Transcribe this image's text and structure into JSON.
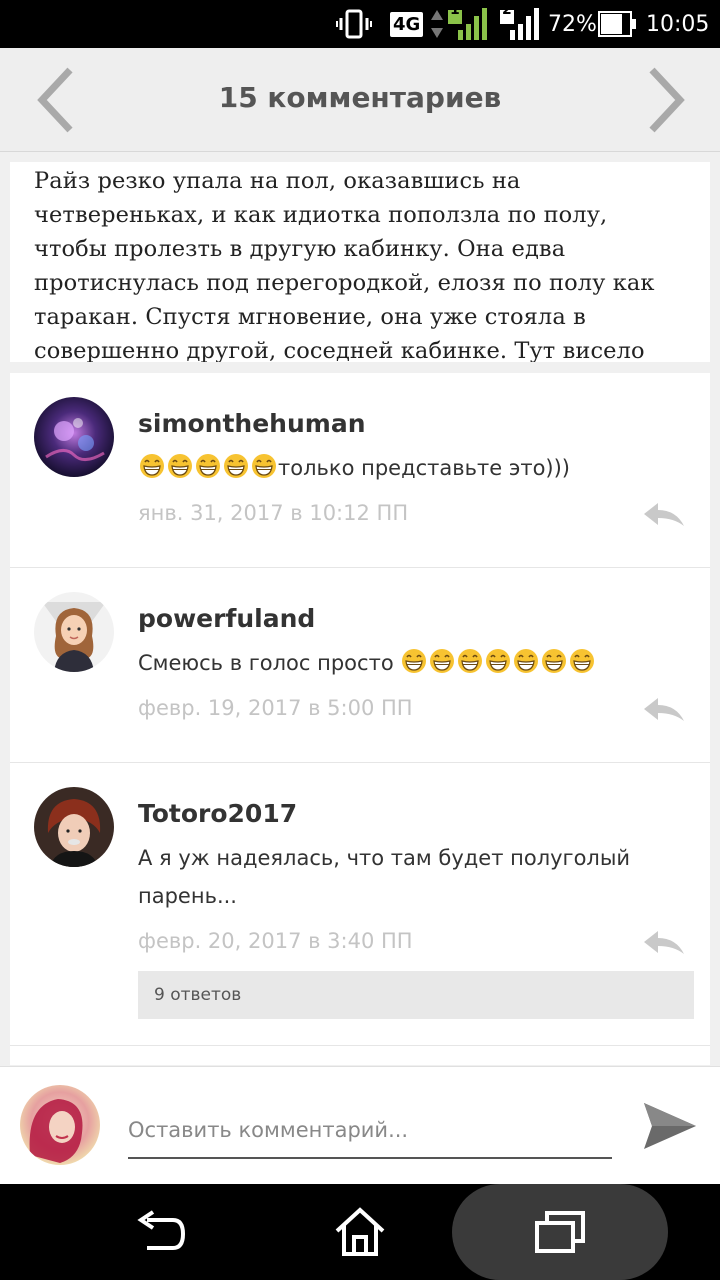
{
  "status_bar": {
    "network_type": "4G",
    "sim1_label": "1",
    "sim2_label": "2",
    "battery_percent": "72%",
    "time": "10:05"
  },
  "header": {
    "title": "15 комментариев",
    "prev_icon": "chevron-left-icon",
    "next_icon": "chevron-right-icon"
  },
  "excerpt": {
    "text": "Райз резко упала на пол, оказавшись на четвереньках, и как идиотка поползла по полу, чтобы пролезть в другую кабинку. Она едва протиснулась под перегородкой, елозя по полу как таракан. Спустя мгновение, она уже стояла в совершенно другой, соседней кабинке. Тут висело чье-то чёрное платье, которое, очевидно, оставили. Райз"
  },
  "comments": [
    {
      "username": "simonthehuman",
      "text": "только представьте это)))",
      "emoji_before": 5,
      "emoji_after": 0,
      "date": "янв. 31, 2017 в 10:12 ПП"
    },
    {
      "username": "powerfuland",
      "text": "Смеюсь в голос просто ",
      "emoji_before": 0,
      "emoji_after": 7,
      "date": "февр. 19, 2017 в 5:00 ПП"
    },
    {
      "username": "Totoro2017",
      "text": "А я уж надеялась, что там будет полуголый парень...",
      "emoji_before": 0,
      "emoji_after": 0,
      "date": "февр. 20, 2017 в 3:40 ПП",
      "replies_label": "9 ответов"
    }
  ],
  "compose": {
    "placeholder": "Оставить комментарий...",
    "send_icon": "send-icon"
  },
  "navbar": {
    "back_icon": "back-icon",
    "home_icon": "home-icon",
    "recents_icon": "recents-icon"
  },
  "colors": {
    "header_bg": "#eeeeee",
    "page_bg": "#f0f0f0",
    "muted_text": "#c4c4c4",
    "emoji_yellow": "#f7c331"
  }
}
